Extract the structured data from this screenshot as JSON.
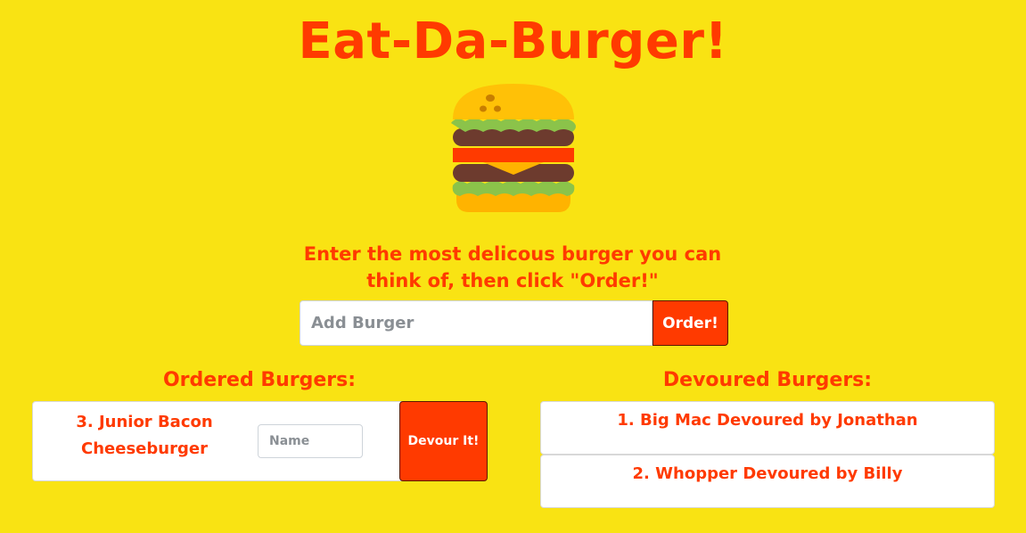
{
  "header": {
    "title": "Eat-Da-Burger!",
    "logo_icon": "burger-icon"
  },
  "order": {
    "prompt_line1": "Enter the most delicous burger you can",
    "prompt_line2": "think of, then click \"Order!\"",
    "input_placeholder": "Add Burger",
    "input_value": "",
    "button_label": "Order!"
  },
  "ordered": {
    "heading": "Ordered Burgers:",
    "items": [
      {
        "label_line1": "3. Junior Bacon",
        "label_line2": "Cheeseburger",
        "name_placeholder": "Name",
        "button_label": "Devour It!"
      }
    ]
  },
  "devoured": {
    "heading": "Devoured Burgers:",
    "items": [
      {
        "label": "1. Big Mac Devoured by Jonathan"
      },
      {
        "label": "2. Whopper Devoured by Billy"
      }
    ]
  },
  "colors": {
    "background": "#f9e313",
    "accent": "#ff3a00",
    "card": "#ffffff"
  }
}
